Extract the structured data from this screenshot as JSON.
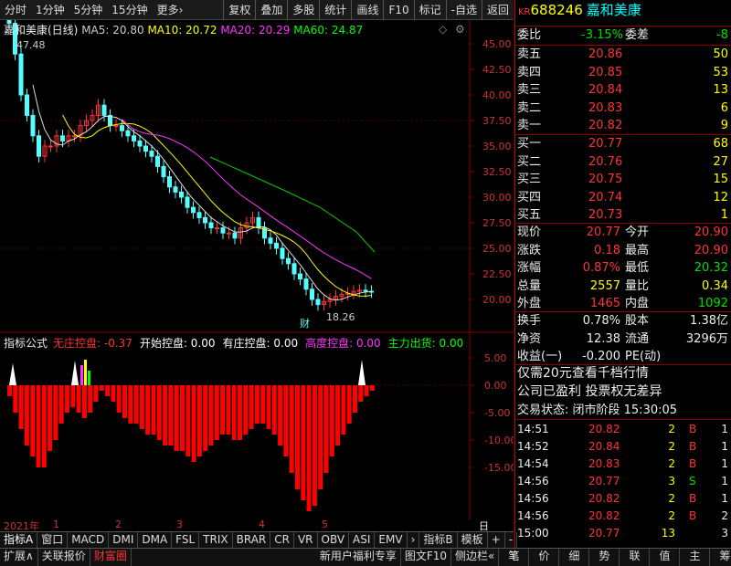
{
  "toolbar": {
    "left": [
      "分时",
      "1分钟",
      "5分钟",
      "15分钟",
      "更多›"
    ],
    "right": [
      "复权",
      "叠加",
      "多股",
      "统计",
      "画线",
      "F10",
      "标记",
      "-自选",
      "返回"
    ]
  },
  "chart": {
    "name": "嘉和美康(日线)",
    "ma5": "MA5: 20.80",
    "ma10": "MA10: 20.72",
    "ma20": "MA20: 20.29",
    "ma60": "MA60: 24.87",
    "high_label": "47.48",
    "low_label": "18.26",
    "marker": "财",
    "price_ticks": [
      "45.00",
      "42.50",
      "40.00",
      "37.50",
      "35.00",
      "32.50",
      "30.00",
      "27.50",
      "25.00",
      "22.50",
      "20.00"
    ],
    "ind_name": "指标公式",
    "ind_items": [
      {
        "label": "无庄控盘: -0.37",
        "color": "#ff3333"
      },
      {
        "label": "开始控盘: 0.00",
        "color": "#ffffff"
      },
      {
        "label": "有庄控盘: 0.00",
        "color": "#ffffff"
      },
      {
        "label": "高度控盘: 0.00",
        "color": "#ff33ff"
      },
      {
        "label": "主力出货: 0.00",
        "color": "#00ff00"
      }
    ],
    "ind_ticks": [
      "5.00",
      "0.00",
      "-5.00",
      "-10.00",
      "-15.00"
    ],
    "dates": [
      "2021年",
      "1",
      "2",
      "3",
      "4",
      "5"
    ],
    "period": "日线"
  },
  "quote": {
    "code": "688246",
    "name": "嘉和美康",
    "kr": "KR",
    "wb_label": "委比",
    "wb": "-3.15%",
    "wc_label": "委差",
    "wc": "-8",
    "sells": [
      {
        "label": "卖五",
        "price": "20.86",
        "vol": "50"
      },
      {
        "label": "卖四",
        "price": "20.85",
        "vol": "53"
      },
      {
        "label": "卖三",
        "price": "20.84",
        "vol": "13"
      },
      {
        "label": "卖二",
        "price": "20.83",
        "vol": "6"
      },
      {
        "label": "卖一",
        "price": "20.82",
        "vol": "9"
      }
    ],
    "buys": [
      {
        "label": "买一",
        "price": "20.77",
        "vol": "68"
      },
      {
        "label": "买二",
        "price": "20.76",
        "vol": "27"
      },
      {
        "label": "买三",
        "price": "20.75",
        "vol": "15"
      },
      {
        "label": "买四",
        "price": "20.74",
        "vol": "12"
      },
      {
        "label": "买五",
        "price": "20.73",
        "vol": "1"
      }
    ],
    "stats": [
      {
        "l1": "现价",
        "v1": "20.77",
        "c1": "red",
        "l2": "今开",
        "v2": "20.90",
        "c2": "red"
      },
      {
        "l1": "涨跌",
        "v1": "0.18",
        "c1": "red",
        "l2": "最高",
        "v2": "20.90",
        "c2": "red"
      },
      {
        "l1": "涨幅",
        "v1": "0.87%",
        "c1": "red",
        "l2": "最低",
        "v2": "20.32",
        "c2": "grn"
      },
      {
        "l1": "总量",
        "v1": "2557",
        "c1": "yel",
        "l2": "量比",
        "v2": "0.34",
        "c2": "yel"
      },
      {
        "l1": "外盘",
        "v1": "1465",
        "c1": "red",
        "l2": "内盘",
        "v2": "1092",
        "c2": "grn"
      }
    ],
    "stats2": [
      {
        "l1": "换手",
        "v1": "0.78%",
        "l2": "股本",
        "v2": "1.38亿"
      },
      {
        "l1": "净资",
        "v1": "12.38",
        "l2": "流通",
        "v2": "3296万"
      },
      {
        "l1": "收益(一)",
        "v1": "-0.200",
        "l2": "PE(动)",
        "v2": ""
      }
    ],
    "promo": "仅需20元查看千档行情",
    "info": "公司已盈利 投票权无差异",
    "status": "交易状态: 闭市阶段 15:30:05",
    "trades": [
      {
        "t": "14:51",
        "p": "20.82",
        "v": "2",
        "bs": "B",
        "n": "1"
      },
      {
        "t": "14:52",
        "p": "20.84",
        "v": "2",
        "bs": "B",
        "n": "1"
      },
      {
        "t": "14:54",
        "p": "20.83",
        "v": "2",
        "bs": "B",
        "n": "1"
      },
      {
        "t": "14:56",
        "p": "20.77",
        "v": "3",
        "bs": "S",
        "n": "1"
      },
      {
        "t": "14:56",
        "p": "20.82",
        "v": "2",
        "bs": "B",
        "n": "1"
      },
      {
        "t": "14:56",
        "p": "20.82",
        "v": "2",
        "bs": "B",
        "n": "2"
      },
      {
        "t": "15:00",
        "p": "20.77",
        "v": "13",
        "bs": "",
        "n": "3"
      }
    ]
  },
  "tabs1": [
    "指标A",
    "窗口",
    "MACD",
    "DMI",
    "DMA",
    "FSL",
    "TRIX",
    "BRAR",
    "CR",
    "VR",
    "OBV",
    "ASI",
    "EMV",
    "›",
    "指标B",
    "模板",
    "+",
    "-"
  ],
  "tabs2": [
    "扩展∧",
    "关联报价",
    "财富圈",
    "新用户福利专享",
    "图文F10",
    "侧边栏«"
  ],
  "side_tabs": [
    "笔",
    "价",
    "细",
    "势",
    "联",
    "值",
    "主",
    "筹"
  ]
}
